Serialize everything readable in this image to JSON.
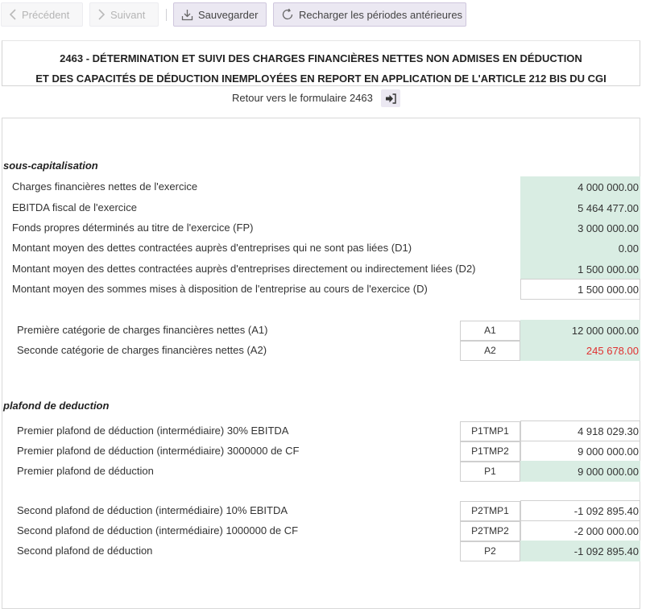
{
  "toolbar": {
    "prev_label": "Précédent",
    "next_label": "Suivant",
    "save_label": "Sauvegarder",
    "reload_label": "Recharger les périodes antérieures"
  },
  "title": {
    "line1": "2463 - DÉTERMINATION ET SUIVI DES CHARGES FINANCIÈRES NETTES NON ADMISES EN DÉDUCTION",
    "line2": "ET DES CAPACITÉS DE DÉDUCTION INEMPLOYÉES EN REPORT EN APPLICATION DE L'ARTICLE 212 BIS DU CGI"
  },
  "return_link": {
    "label": "Retour vers le formulaire 2463"
  },
  "sous_capitalisation": {
    "title": "sous-capitalisation",
    "rows": [
      {
        "label": "Charges financières nettes de l'exercice",
        "value": "4 000 000.00"
      },
      {
        "label": "EBITDA fiscal de l'exercice",
        "value": "5 464 477.00"
      },
      {
        "label": "Fonds propres déterminés au titre de l'exercice (FP)",
        "value": "3 000 000.00"
      },
      {
        "label": "Montant moyen des dettes contractées auprès d'entreprises qui ne sont pas liées (D1)",
        "value": "0.00"
      },
      {
        "label": "Montant moyen des dettes contractées auprès d'entreprises directement ou indirectement liées (D2)",
        "value": "1 500 000.00"
      },
      {
        "label": "Montant moyen des sommes mises à disposition de l'entreprise au cours de l'exercice (D)",
        "value": "1 500 000.00"
      }
    ],
    "categories": [
      {
        "label": "Première catégorie de charges financières nettes (A1)",
        "code": "A1",
        "value": "12 000 000.00"
      },
      {
        "label": "Seconde catégorie de charges financières nettes (A2)",
        "code": "A2",
        "value": "245 678.00"
      }
    ]
  },
  "plafond": {
    "title": "plafond de deduction",
    "first": [
      {
        "label": "Premier plafond de déduction (intermédiaire) 30% EBITDA",
        "code": "P1TMP1",
        "value": "4 918 029.30"
      },
      {
        "label": "Premier plafond de déduction (intermédiaire) 3000000 de CF",
        "code": "P1TMP2",
        "value": "9 000 000.00"
      },
      {
        "label": "Premier plafond de déduction",
        "code": "P1",
        "value": "9 000 000.00"
      }
    ],
    "second": [
      {
        "label": "Second plafond de déduction (intermédiaire) 10% EBITDA",
        "code": "P2TMP1",
        "value": "-1 092 895.40"
      },
      {
        "label": "Second plafond de déduction (intermédiaire) 1000000 de CF",
        "code": "P2TMP2",
        "value": "-2 000 000.00"
      },
      {
        "label": "Second plafond de déduction",
        "code": "P2",
        "value": "-1 092 895.40"
      }
    ]
  },
  "colors": {
    "accent_bg": "#ebe8f2",
    "computed_bg": "#d9ede3",
    "negative": "#e03131"
  }
}
